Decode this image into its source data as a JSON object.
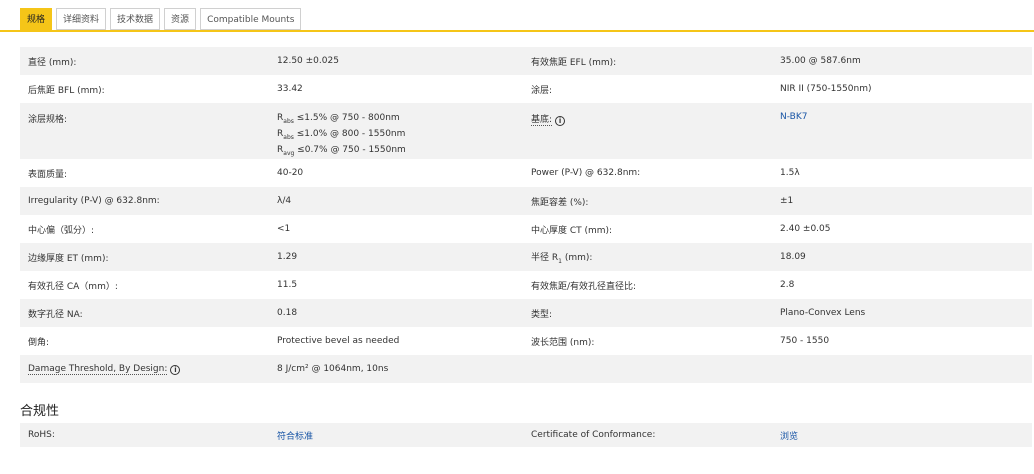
{
  "tabs": [
    "规格",
    "详细资料",
    "技术数据",
    "资源",
    "Compatible Mounts"
  ],
  "colors": {
    "accent": "#f5c518",
    "link": "#1a56a6",
    "stripe": "#f2f2f2"
  },
  "specs": {
    "r1": {
      "k1": "直径 (mm):",
      "v1": "12.50 ±0.025",
      "k2": "有效焦距 EFL (mm):",
      "v2": "35.00 @ 587.6nm"
    },
    "r2": {
      "k1": "后焦距 BFL (mm):",
      "v1": "33.42",
      "k2": "涂层:",
      "v2": "NIR II (750-1550nm)"
    },
    "r3": {
      "k1": "涂层规格:",
      "coating_lines": [
        {
          "sym": "R",
          "sub": "abs",
          "text": " ≤1.5% @ 750 - 800nm"
        },
        {
          "sym": "R",
          "sub": "abs",
          "text": " ≤1.0% @ 800 - 1550nm"
        },
        {
          "sym": "R",
          "sub": "avg",
          "text": " ≤0.7% @ 750 - 1550nm"
        }
      ],
      "k2": "基底:",
      "v2": "N-BK7"
    },
    "r4": {
      "k1": "表面质量:",
      "v1": "40-20",
      "k2": "Power (P-V) @ 632.8nm:",
      "v2": "1.5λ"
    },
    "r5": {
      "k1": "Irregularity (P-V) @ 632.8nm:",
      "v1": "λ/4",
      "k2": "焦距容差 (%):",
      "v2": "±1"
    },
    "r6": {
      "k1": "中心偏（弧分）:",
      "v1": "<1",
      "k2": "中心厚度 CT (mm):",
      "v2": "2.40 ±0.05"
    },
    "r7": {
      "k1": "边缘厚度 ET (mm):",
      "v1": "1.29",
      "k2_pre": "半径 R",
      "k2_sub": "1",
      "k2_post": " (mm):",
      "v2": "18.09"
    },
    "r8": {
      "k1": "有效孔径 CA（mm）:",
      "v1": "11.5",
      "k2": "有效焦距/有效孔径直径比:",
      "v2": "2.8"
    },
    "r9": {
      "k1": "数字孔径 NA:",
      "v1": "0.18",
      "k2": "类型:",
      "v2": "Plano-Convex Lens"
    },
    "r10": {
      "k1": "倒角:",
      "v1": "Protective bevel as needed",
      "k2": "波长范围 (nm):",
      "v2": "750 - 1550"
    },
    "r11": {
      "k1": "Damage Threshold, By Design:",
      "v1": "8 J/cm² @ 1064nm, 10ns"
    }
  },
  "info_icon": "i",
  "compliance": {
    "title": "合规性",
    "rohs_label": "RoHS:",
    "rohs_value": "符合标准",
    "coc_label": "Certificate of Conformance:",
    "coc_value": "浏览"
  }
}
